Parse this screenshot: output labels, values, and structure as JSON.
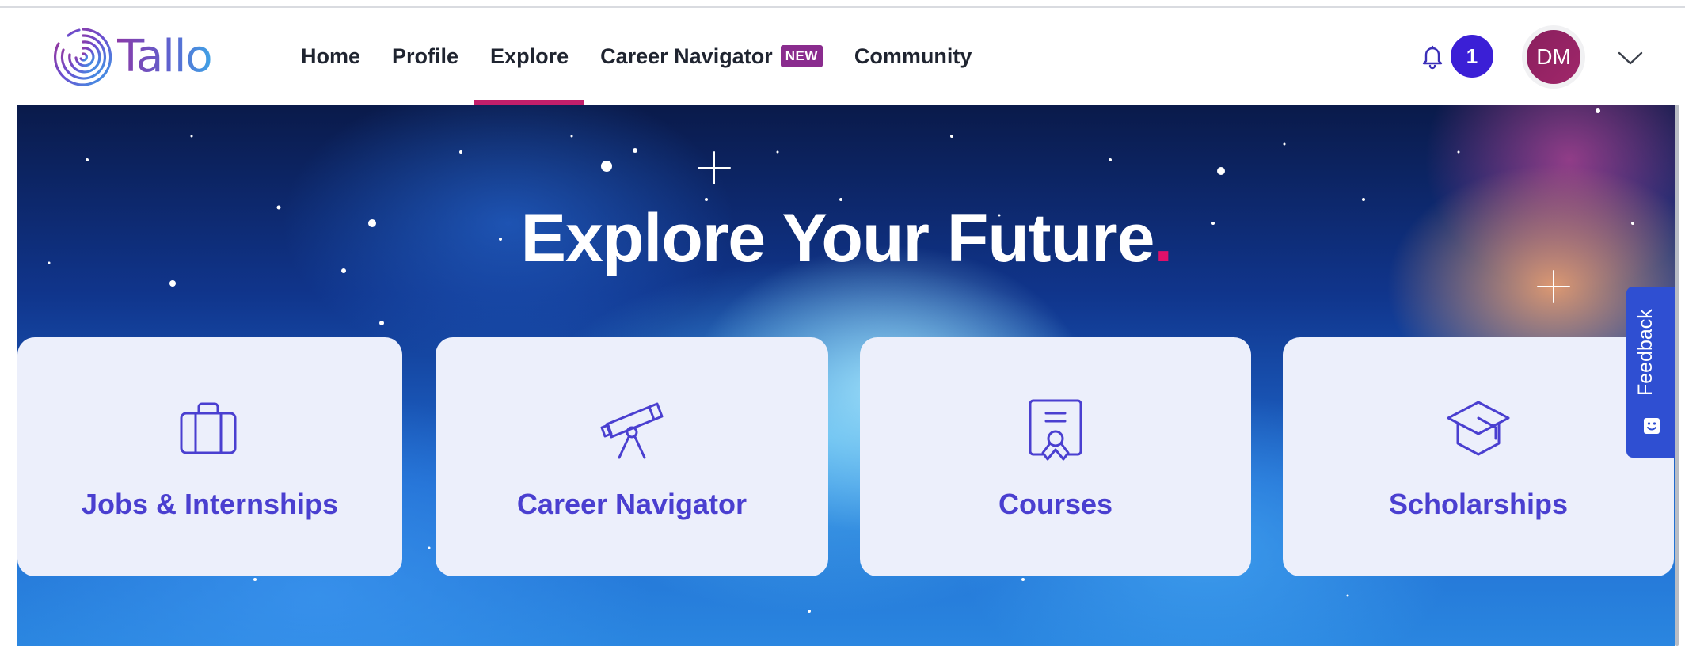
{
  "brand": {
    "name": "Tallo",
    "icon": "fingerprint-logo-icon"
  },
  "nav": {
    "items": [
      {
        "label": "Home"
      },
      {
        "label": "Profile"
      },
      {
        "label": "Explore",
        "active": true
      },
      {
        "label": "Career Navigator",
        "badge": "NEW"
      },
      {
        "label": "Community"
      }
    ]
  },
  "notifications": {
    "icon": "bell-icon",
    "count": "1"
  },
  "user": {
    "initials": "DM",
    "menu_icon": "chevron-down-icon"
  },
  "hero": {
    "title": "Explore Your Future",
    "title_dot": ".",
    "cards": [
      {
        "label": "Jobs & Internships",
        "icon": "briefcase-icon"
      },
      {
        "label": "Career Navigator",
        "icon": "telescope-icon"
      },
      {
        "label": "Courses",
        "icon": "certificate-icon"
      },
      {
        "label": "Scholarships",
        "icon": "graduation-cap-icon"
      }
    ]
  },
  "feedback": {
    "label": "Feedback",
    "icon": "smiley-icon"
  },
  "colors": {
    "accent": "#c21f6b",
    "notification": "#3b1fd6",
    "avatar": "#8a1f5e",
    "card_text": "#4a3fd0",
    "card_bg": "#eceffb",
    "feedback_bg": "#2f4fd2"
  }
}
